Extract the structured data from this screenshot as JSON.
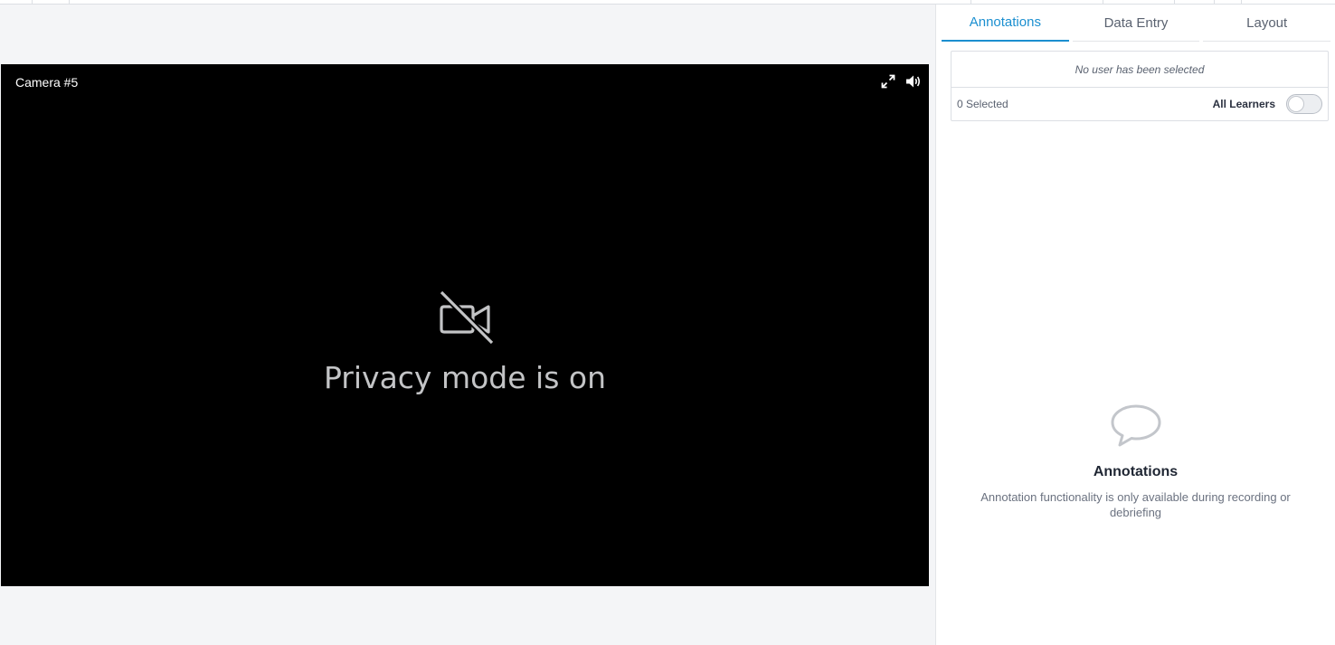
{
  "player": {
    "camera_title": "Camera #5",
    "privacy_message": "Privacy mode is on",
    "icons": [
      "fullscreen-icon",
      "volume-icon",
      "camera-off-icon"
    ]
  },
  "panel": {
    "tabs": [
      {
        "label": "Annotations",
        "active": true
      },
      {
        "label": "Data Entry",
        "active": false
      },
      {
        "label": "Layout",
        "active": false
      }
    ],
    "learners": {
      "no_user_text": "No user has been selected",
      "selected_count": "0 Selected",
      "all_learners_label": "All Learners",
      "all_learners_on": false
    },
    "empty_state": {
      "icon": "speech-bubble-icon",
      "title": "Annotations",
      "description": "Annotation functionality is only available during recording or debriefing"
    }
  },
  "colors": {
    "accent": "#1b8fd0",
    "player_bg": "#000000",
    "page_bg": "#f4f5f7"
  }
}
